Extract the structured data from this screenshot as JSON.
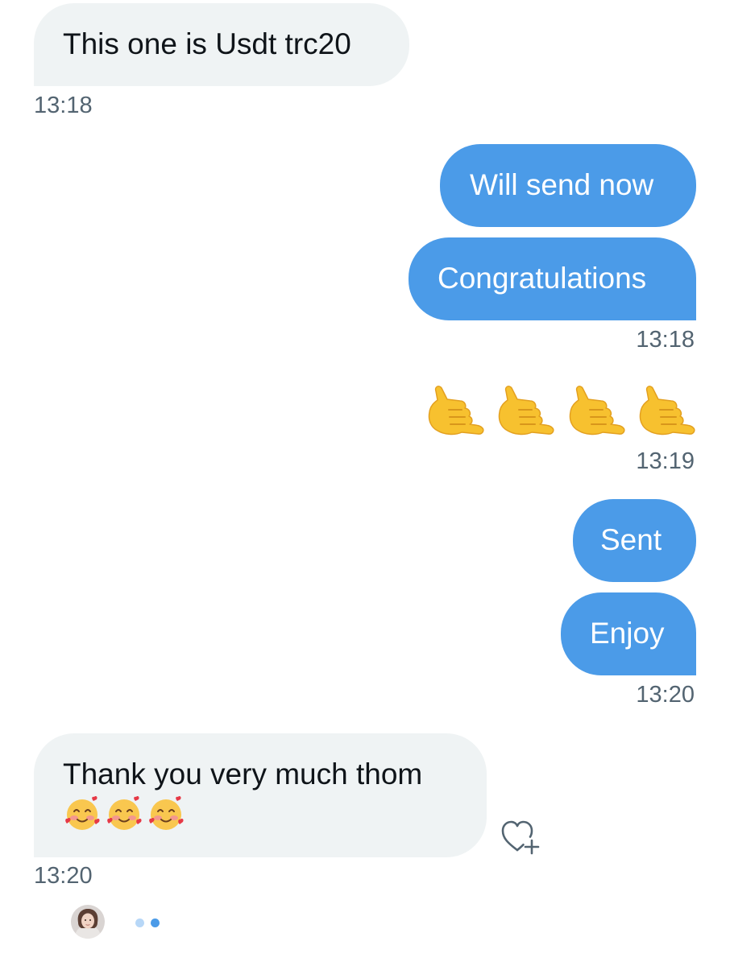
{
  "colors": {
    "incoming_bubble": "#eff3f4",
    "outgoing_bubble": "#4b9be8",
    "timestamp": "#536471",
    "typing_dot_light": "#b7d7f7",
    "typing_dot_dark": "#4b9be8"
  },
  "messages": [
    {
      "id": "m1",
      "direction": "incoming",
      "text": "This one is Usdt trc20",
      "time": "13:18"
    },
    {
      "id": "m2",
      "direction": "outgoing",
      "text": "Will send now"
    },
    {
      "id": "m3",
      "direction": "outgoing",
      "text": "Congratulations",
      "time": "13:18"
    },
    {
      "id": "m4",
      "direction": "outgoing",
      "emoji": "call-me-hand x4",
      "time": "13:19"
    },
    {
      "id": "m5",
      "direction": "outgoing",
      "text": "Sent"
    },
    {
      "id": "m6",
      "direction": "outgoing",
      "text": "Enjoy",
      "time": "13:20"
    },
    {
      "id": "m7",
      "direction": "incoming",
      "text": "Thank you very much thom",
      "emoji": "smiling-face-with-hearts x3",
      "time": "13:20"
    }
  ],
  "icons": {
    "like": "heart-plus-icon",
    "avatar": "user-avatar",
    "typing": "typing-indicator"
  }
}
